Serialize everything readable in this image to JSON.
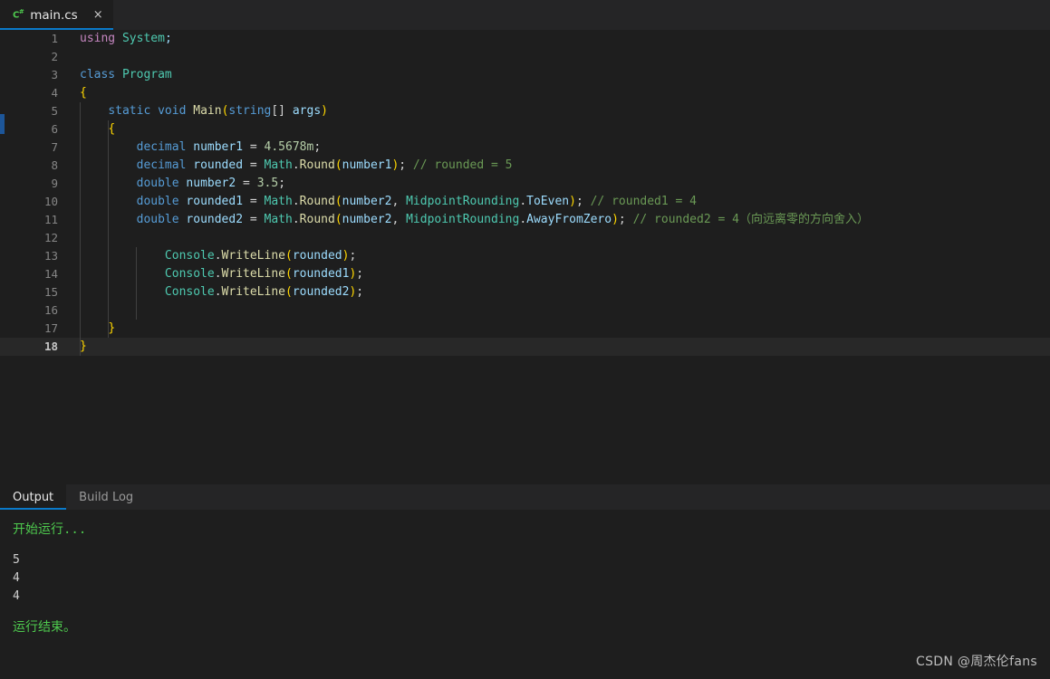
{
  "window": {
    "background": "#1e1e1e",
    "accent": "#0a7aca"
  },
  "editor_tabs": [
    {
      "icon": "csharp-file-icon",
      "icon_letter": "C",
      "icon_sup": "#",
      "title": "main.cs",
      "close_label": "×",
      "active": true
    }
  ],
  "code": {
    "language": "csharp",
    "lines": [
      {
        "num": "1",
        "text": "using System;"
      },
      {
        "num": "2",
        "text": ""
      },
      {
        "num": "3",
        "text": "class Program"
      },
      {
        "num": "4",
        "text": "{"
      },
      {
        "num": "5",
        "text": "    static void Main(string[] args)"
      },
      {
        "num": "6",
        "text": "    {"
      },
      {
        "num": "7",
        "text": "        decimal number1 = 4.5678m;"
      },
      {
        "num": "8",
        "text": "        decimal rounded = Math.Round(number1); // rounded = 5"
      },
      {
        "num": "9",
        "text": "        double number2 = 3.5;"
      },
      {
        "num": "10",
        "text": "        double rounded1 = Math.Round(number2, MidpointRounding.ToEven); // rounded1 = 4"
      },
      {
        "num": "11",
        "text": "        double rounded2 = Math.Round(number2, MidpointRounding.AwayFromZero); // rounded2 = 4（向远离零的方向舍入）"
      },
      {
        "num": "12",
        "text": ""
      },
      {
        "num": "13",
        "text": "            Console.WriteLine(rounded);"
      },
      {
        "num": "14",
        "text": "            Console.WriteLine(rounded1);"
      },
      {
        "num": "15",
        "text": "            Console.WriteLine(rounded2);"
      },
      {
        "num": "16",
        "text": ""
      },
      {
        "num": "17",
        "text": "    }"
      },
      {
        "num": "18",
        "text": "}",
        "current": true
      }
    ],
    "tokens": {
      "l1": [
        [
          "using",
          "ct"
        ],
        [
          " ",
          ""
        ],
        [
          "System",
          "t"
        ],
        [
          ";",
          "v"
        ]
      ],
      "l3": [
        [
          "class",
          "k"
        ],
        [
          " ",
          ""
        ],
        [
          "Program",
          "t"
        ]
      ],
      "l4": [
        [
          "{",
          "br1"
        ]
      ],
      "l5": [
        [
          "static",
          "k"
        ],
        [
          " ",
          ""
        ],
        [
          "void",
          "k"
        ],
        [
          " ",
          ""
        ],
        [
          "Main",
          "f"
        ],
        [
          "(",
          "br1"
        ],
        [
          "string",
          "k"
        ],
        [
          "[] ",
          "p"
        ],
        [
          "args",
          "v"
        ],
        [
          ")",
          "br1"
        ]
      ],
      "l6": [
        [
          "{",
          "br1"
        ]
      ],
      "l7": [
        [
          "decimal",
          "k"
        ],
        [
          " ",
          ""
        ],
        [
          "number1",
          "v"
        ],
        [
          " = ",
          "p"
        ],
        [
          "4.5678m",
          "n"
        ],
        [
          ";",
          "p"
        ]
      ],
      "l8": [
        [
          "decimal",
          "k"
        ],
        [
          " ",
          ""
        ],
        [
          "rounded",
          "v"
        ],
        [
          " = ",
          "p"
        ],
        [
          "Math",
          "t"
        ],
        [
          ".",
          "p"
        ],
        [
          "Round",
          "f"
        ],
        [
          "(",
          "br1"
        ],
        [
          "number1",
          "v"
        ],
        [
          ")",
          "br1"
        ],
        [
          "; ",
          "p"
        ],
        [
          "// rounded = 5",
          "c"
        ]
      ],
      "l9": [
        [
          "double",
          "k"
        ],
        [
          " ",
          ""
        ],
        [
          "number2",
          "v"
        ],
        [
          " = ",
          "p"
        ],
        [
          "3.5",
          "n"
        ],
        [
          ";",
          "p"
        ]
      ],
      "l10": [
        [
          "double",
          "k"
        ],
        [
          " ",
          ""
        ],
        [
          "rounded1",
          "v"
        ],
        [
          " = ",
          "p"
        ],
        [
          "Math",
          "t"
        ],
        [
          ".",
          "p"
        ],
        [
          "Round",
          "f"
        ],
        [
          "(",
          "br1"
        ],
        [
          "number2",
          "v"
        ],
        [
          ", ",
          "p"
        ],
        [
          "MidpointRounding",
          "t"
        ],
        [
          ".",
          "p"
        ],
        [
          "ToEven",
          "v"
        ],
        [
          ")",
          "br1"
        ],
        [
          "; ",
          "p"
        ],
        [
          "// rounded1 = 4",
          "c"
        ]
      ],
      "l11": [
        [
          "double",
          "k"
        ],
        [
          " ",
          ""
        ],
        [
          "rounded2",
          "v"
        ],
        [
          " = ",
          "p"
        ],
        [
          "Math",
          "t"
        ],
        [
          ".",
          "p"
        ],
        [
          "Round",
          "f"
        ],
        [
          "(",
          "br1"
        ],
        [
          "number2",
          "v"
        ],
        [
          ", ",
          "p"
        ],
        [
          "MidpointRounding",
          "t"
        ],
        [
          ".",
          "p"
        ],
        [
          "AwayFromZero",
          "v"
        ],
        [
          ")",
          "br1"
        ],
        [
          "; ",
          "p"
        ],
        [
          "// rounded2 = 4（向远离零的方向舍入）",
          "c"
        ]
      ],
      "l13": [
        [
          "Console",
          "t"
        ],
        [
          ".",
          "p"
        ],
        [
          "WriteLine",
          "f"
        ],
        [
          "(",
          "br1"
        ],
        [
          "rounded",
          "v"
        ],
        [
          ")",
          "br1"
        ],
        [
          ";",
          "p"
        ]
      ],
      "l14": [
        [
          "Console",
          "t"
        ],
        [
          ".",
          "p"
        ],
        [
          "WriteLine",
          "f"
        ],
        [
          "(",
          "br1"
        ],
        [
          "rounded1",
          "v"
        ],
        [
          ")",
          "br1"
        ],
        [
          ";",
          "p"
        ]
      ],
      "l15": [
        [
          "Console",
          "t"
        ],
        [
          ".",
          "p"
        ],
        [
          "WriteLine",
          "f"
        ],
        [
          "(",
          "br1"
        ],
        [
          "rounded2",
          "v"
        ],
        [
          ")",
          "br1"
        ],
        [
          ";",
          "p"
        ]
      ],
      "l17": [
        [
          "}",
          "br1"
        ]
      ],
      "l18": [
        [
          "}",
          "br1"
        ]
      ]
    }
  },
  "panel": {
    "tabs": [
      {
        "label": "Output",
        "active": true
      },
      {
        "label": "Build Log",
        "active": false
      }
    ],
    "output": [
      {
        "text": "开始运行...",
        "style": "green"
      },
      {
        "text": "",
        "style": "gap"
      },
      {
        "text": "5",
        "style": "plain"
      },
      {
        "text": "4",
        "style": "plain"
      },
      {
        "text": "4",
        "style": "plain"
      },
      {
        "text": "",
        "style": "gap"
      },
      {
        "text": "运行结束。",
        "style": "green"
      }
    ]
  },
  "watermark": {
    "text": "CSDN @周杰伦fans"
  }
}
